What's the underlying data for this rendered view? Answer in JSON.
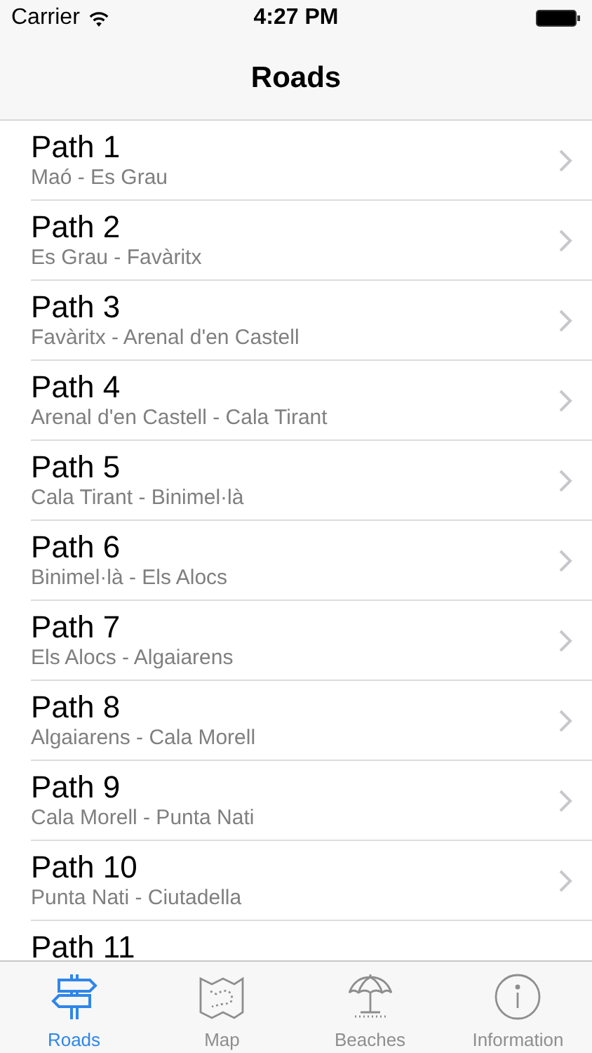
{
  "status_bar": {
    "carrier": "Carrier",
    "time": "4:27 PM"
  },
  "nav_bar": {
    "title": "Roads"
  },
  "rows": [
    {
      "title": "Path 1",
      "subtitle": "Maó - Es Grau"
    },
    {
      "title": "Path 2",
      "subtitle": "Es Grau - Favàritx"
    },
    {
      "title": "Path 3",
      "subtitle": "Favàritx - Arenal d'en Castell"
    },
    {
      "title": "Path 4",
      "subtitle": "Arenal d'en Castell - Cala Tirant"
    },
    {
      "title": "Path 5",
      "subtitle": "Cala Tirant - Binimel·là"
    },
    {
      "title": "Path 6",
      "subtitle": "Binimel·là - Els Alocs"
    },
    {
      "title": "Path 7",
      "subtitle": "Els Alocs - Algaiarens"
    },
    {
      "title": "Path 8",
      "subtitle": "Algaiarens - Cala Morell"
    },
    {
      "title": "Path 9",
      "subtitle": "Cala Morell - Punta Nati"
    },
    {
      "title": "Path 10",
      "subtitle": "Punta Nati - Ciutadella"
    },
    {
      "title": "Path 11"
    }
  ],
  "tab_bar": [
    {
      "label": "Roads",
      "kind": "signpost",
      "selected": true
    },
    {
      "label": "Map",
      "kind": "map",
      "selected": false
    },
    {
      "label": "Beaches",
      "kind": "umbrella",
      "selected": false
    },
    {
      "label": "Information",
      "kind": "info",
      "selected": false
    }
  ]
}
